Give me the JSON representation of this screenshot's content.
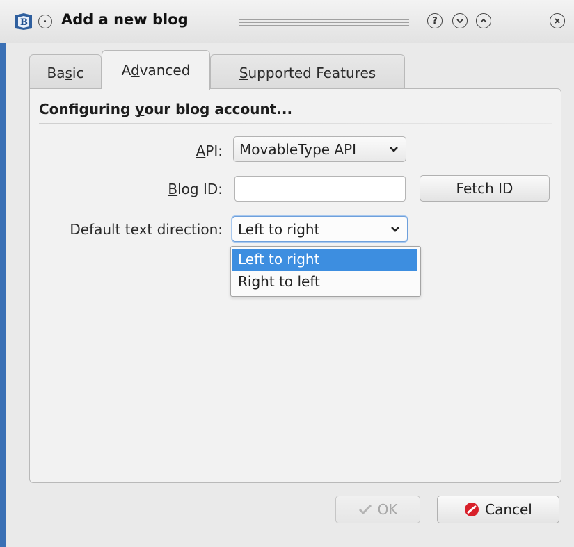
{
  "window": {
    "title": "Add a new blog",
    "title_buttons": [
      "help",
      "minimize",
      "maximize",
      "close"
    ]
  },
  "tabs": [
    {
      "label_pre": "Ba",
      "mnemonic": "s",
      "label_post": "ic",
      "active": false
    },
    {
      "label_pre": "A",
      "mnemonic": "d",
      "label_post": "vanced",
      "active": true
    },
    {
      "label_pre": "",
      "mnemonic": "S",
      "label_post": "upported Features",
      "active": false
    }
  ],
  "section": {
    "title_pre": "Configuring ",
    "title_mnemonic": "y",
    "title_post": "our blog account..."
  },
  "form": {
    "api": {
      "label_pre": "",
      "mnemonic": "A",
      "label_post": "PI:",
      "value": "MovableType API"
    },
    "blog_id": {
      "label_pre": "",
      "mnemonic": "B",
      "label_post": "log ID:",
      "value": ""
    },
    "fetch_button": {
      "label_pre": "",
      "mnemonic": "F",
      "label_post": "etch ID"
    },
    "direction": {
      "label_pre": "Default ",
      "mnemonic": "t",
      "label_post": "ext direction:",
      "value": "Left to right",
      "options": [
        "Left to right",
        "Right to left"
      ],
      "selected_index": 0
    }
  },
  "buttons": {
    "ok": {
      "mnemonic": "O",
      "label_post": "K",
      "enabled": false
    },
    "cancel": {
      "mnemonic": "C",
      "label_post": "ancel",
      "enabled": true
    }
  },
  "colors": {
    "selection": "#3d8ee0",
    "window_edge": "#3a70b5",
    "cancel_icon": "#d8202a"
  }
}
